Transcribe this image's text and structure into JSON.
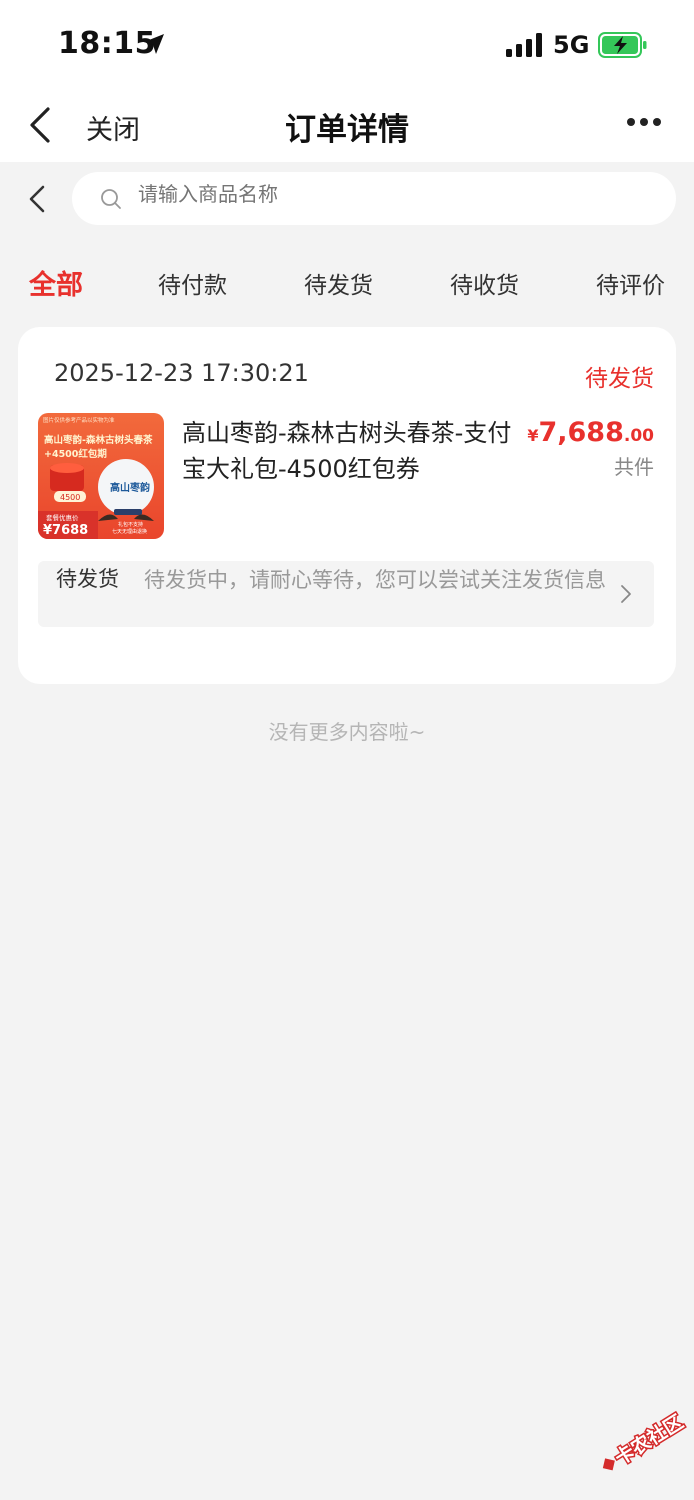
{
  "status_bar": {
    "time": "18:15",
    "network": "5G",
    "battery_color": "#34c759"
  },
  "nav": {
    "close_label": "关闭",
    "title": "订单详情"
  },
  "search": {
    "placeholder": "请输入商品名称"
  },
  "tabs": [
    {
      "label": "全部",
      "active": true
    },
    {
      "label": "待付款"
    },
    {
      "label": "待发货"
    },
    {
      "label": "待收货"
    },
    {
      "label": "待评价"
    }
  ],
  "order": {
    "time": "2025-12-23 17:30:21",
    "status": "待发货",
    "product_name": "高山枣韵-森林古树头春茶-支付宝大礼包-4500红包券",
    "price_symbol": "¥",
    "price_int": "7,688",
    "price_dec": ".00",
    "qty_label": "共件",
    "thumb": {
      "top_note": "图片仅供参考产品以实物为准",
      "title_line1": "高山枣韵-森林古树头春茶",
      "title_line2": "+4500红包期",
      "coupon_value": "4500",
      "brand_seal": "高山枣韵",
      "price_label": "套餐优惠价",
      "price_value": "¥7688",
      "note1": "礼包不支持",
      "note2": "七天无理由退换"
    },
    "logistics_label": "待发货",
    "logistics_text": "待发货中，请耐心等待，您可以尝试关注发货信息"
  },
  "footer": {
    "no_more": "没有更多内容啦~"
  },
  "watermark": {
    "text": "卡农社区"
  },
  "colors": {
    "accent": "#e8312d",
    "background": "#f3f3f3"
  }
}
